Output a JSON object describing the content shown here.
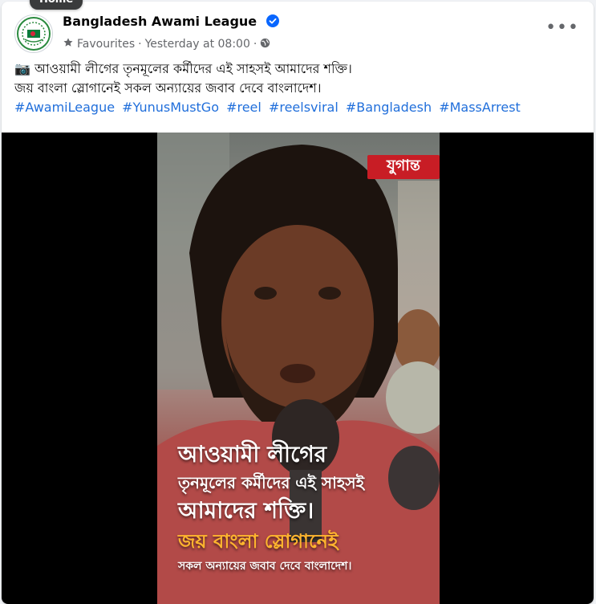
{
  "tooltip": "Home",
  "header": {
    "page_name": "Bangladesh Awami League",
    "audience": "Favourites",
    "separator": "·",
    "timestamp": "Yesterday at 08:00",
    "more_label": "•••"
  },
  "post": {
    "line1_icon": "📷",
    "line1_text": "আওয়ামী লীগের তৃনমূলের কর্মীদের এই সাহসই আমাদের শক্তি।",
    "line2_text": "জয় বাংলা স্লোগানেই সকল অন্যায়ের জবাব দেবে বাংলাদেশ।",
    "hashtags": [
      "#AwamiLeague",
      "#YunusMustGo",
      "#reel",
      "#reelsviral",
      "#Bangladesh",
      "#MassArrest"
    ]
  },
  "video": {
    "badge": "যুগান্ত",
    "caption_lines": [
      "আওয়ামী লীগের",
      "তৃনমূলের কর্মীদের এই সাহসই",
      "আমাদের শক্তি।",
      "জয় বাংলা স্লোগানেই",
      "সকল অন্যায়ের জবাব দেবে বাংলাদেশ।"
    ]
  },
  "colors": {
    "link": "#216fdb",
    "verified": "#0866ff",
    "caption_highlight": "#ffb52e"
  }
}
